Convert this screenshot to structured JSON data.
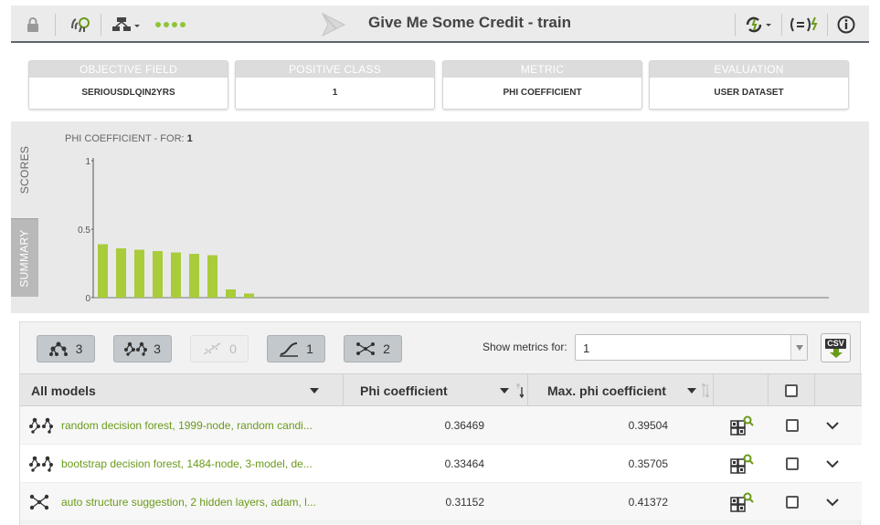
{
  "toolbar": {
    "title": "Give Me Some Credit - train",
    "icons": [
      "lock-icon",
      "fingerprint-icon",
      "model-tree-icon",
      "progress-dots-icon",
      "logo-icon",
      "refresh-lightning-icon",
      "formula-icon",
      "info-icon"
    ]
  },
  "cards": [
    {
      "label": "OBJECTIVE FIELD",
      "value": "SERIOUSDLQIN2YRS"
    },
    {
      "label": "POSITIVE CLASS",
      "value": "1"
    },
    {
      "label": "METRIC",
      "value": "PHI COEFFICIENT"
    },
    {
      "label": "EVALUATION",
      "value": "USER DATASET"
    }
  ],
  "tabs": {
    "scores": "SCORES",
    "summary": "SUMMARY"
  },
  "chart": {
    "title_prefix": "PHI COEFFICIENT - FOR:",
    "title_value": "1"
  },
  "chart_data": {
    "type": "bar",
    "title": "PHI COEFFICIENT - FOR: 1",
    "yticks": [
      "1",
      "0.5",
      "0"
    ],
    "ylim": [
      0,
      1
    ],
    "values": [
      0.39,
      0.36,
      0.35,
      0.34,
      0.33,
      0.32,
      0.31,
      0.06,
      0.03
    ],
    "bar_color": "#a9cc3a",
    "grid": false
  },
  "filters": [
    {
      "icon": "decision-tree-icon",
      "count": "3",
      "enabled": true
    },
    {
      "icon": "ensemble-icon",
      "count": "3",
      "enabled": true
    },
    {
      "icon": "linear-regression-icon",
      "count": "0",
      "enabled": false
    },
    {
      "icon": "logistic-regression-icon",
      "count": "1",
      "enabled": true
    },
    {
      "icon": "deepnet-icon",
      "count": "2",
      "enabled": true
    }
  ],
  "metrics_selector": {
    "label": "Show metrics for:",
    "value": "1"
  },
  "csv_label": "CSV",
  "table": {
    "headers": {
      "models": "All models",
      "phi": "Phi coefficient",
      "max_phi": "Max. phi coefficient"
    },
    "rows": [
      {
        "icon": "ensemble-icon",
        "name": "random decision forest, 1999-node, random candi...",
        "phi": "0.36469",
        "max_phi": "0.39504"
      },
      {
        "icon": "ensemble-icon",
        "name": "bootstrap decision forest, 1484-node, 3-model, de...",
        "phi": "0.33464",
        "max_phi": "0.35705"
      },
      {
        "icon": "deepnet-icon",
        "name": "auto structure suggestion, 2 hidden layers, adam, l...",
        "phi": "0.31152",
        "max_phi": "0.41372"
      }
    ]
  },
  "colors": {
    "accent_green": "#a9cc3a",
    "link_green": "#6a9a1a",
    "toolbar_bg": "#ebebeb"
  }
}
